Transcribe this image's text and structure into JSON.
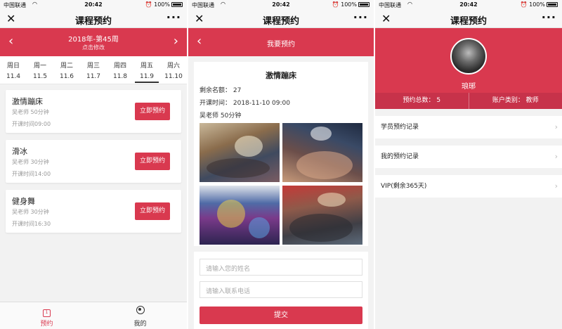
{
  "status": {
    "carrier": "中国联通",
    "time": "20:42",
    "battery": "100%"
  },
  "p1": {
    "nav_title": "课程预约",
    "week_title": "2018年-第45周",
    "week_sub": "点击修改",
    "days": [
      {
        "name": "周日",
        "date": "11.4"
      },
      {
        "name": "周一",
        "date": "11.5"
      },
      {
        "name": "周二",
        "date": "11.6"
      },
      {
        "name": "周三",
        "date": "11.7"
      },
      {
        "name": "周四",
        "date": "11.8"
      },
      {
        "name": "周五",
        "date": "11.9"
      },
      {
        "name": "周六",
        "date": "11.10"
      }
    ],
    "courses": [
      {
        "name": "激情蹦床",
        "teacher": "吴老师 50分钟",
        "open": "开课时间09:00",
        "button": "立即预约"
      },
      {
        "name": "滑冰",
        "teacher": "吴老师 30分钟",
        "open": "开课时间14:00",
        "button": "立即预约"
      },
      {
        "name": "健身舞",
        "teacher": "吴老师 30分钟",
        "open": "开课时间16:30",
        "button": "立即预约"
      }
    ],
    "tabs": {
      "book": "预约",
      "mine": "我的"
    }
  },
  "p2": {
    "nav_title": "课程预约",
    "header": "我要预约",
    "course_title": "激情蹦床",
    "remaining": "剩余名额： 27",
    "open_time": "开课时间： 2018-11-10 09:00",
    "teacher": "吴老师 50分钟",
    "name_placeholder": "请输入您的姓名",
    "phone_placeholder": "请输入联系电话",
    "submit": "提交"
  },
  "p3": {
    "nav_title": "课程预约",
    "name": "琅琊",
    "total": "预约总数： 5",
    "account": "账户类别： 教师",
    "menu": [
      "学员预约记录",
      "我的预约记录",
      "VIP(剩余365天)"
    ]
  }
}
